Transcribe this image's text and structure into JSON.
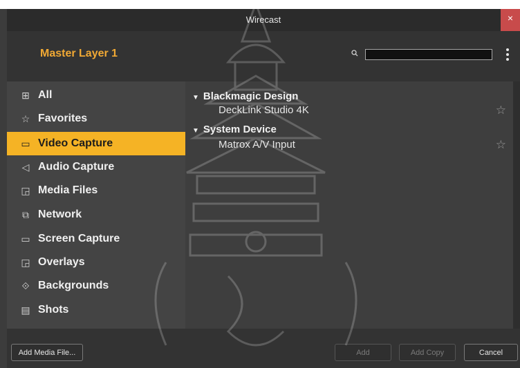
{
  "window": {
    "title": "Wirecast",
    "close_glyph": "×"
  },
  "header": {
    "layer_name": "Master Layer 1",
    "search_value": "",
    "search_icon": "search-icon",
    "more_icon": "⋮"
  },
  "sidebar": {
    "items": [
      {
        "label": "All",
        "icon": "⊞",
        "icon_name": "grid-icon",
        "active": false
      },
      {
        "label": "Favorites",
        "icon": "☆",
        "icon_name": "star-icon",
        "active": false
      },
      {
        "label": "Video Capture",
        "icon": "▭",
        "icon_name": "camera-icon",
        "active": true
      },
      {
        "label": "Audio Capture",
        "icon": "◁",
        "icon_name": "speaker-icon",
        "active": false
      },
      {
        "label": "Media Files",
        "icon": "◲",
        "icon_name": "media-files-icon",
        "active": false
      },
      {
        "label": "Network",
        "icon": "⧉",
        "icon_name": "network-icon",
        "active": false
      },
      {
        "label": "Screen Capture",
        "icon": "▭",
        "icon_name": "monitor-icon",
        "active": false
      },
      {
        "label": "Overlays",
        "icon": "◲",
        "icon_name": "overlays-icon",
        "active": false
      },
      {
        "label": "Backgrounds",
        "icon": "⟐",
        "icon_name": "layers-icon",
        "active": false
      },
      {
        "label": "Shots",
        "icon": "▤",
        "icon_name": "shots-icon",
        "active": false
      }
    ]
  },
  "main": {
    "groups": [
      {
        "name": "Blackmagic Design",
        "devices": [
          "DeckLink Studio 4K"
        ]
      },
      {
        "name": "System Device",
        "devices": [
          "Matrox A/V Input"
        ]
      }
    ],
    "star_glyph": "☆",
    "triangle_glyph": "▼"
  },
  "footer": {
    "add_media_label": "Add Media File...",
    "add_label": "Add",
    "add_copy_label": "Add Copy",
    "cancel_label": "Cancel"
  },
  "colors": {
    "accent": "#f5b325",
    "layer_title": "#f1a934",
    "close": "#c84b4b"
  }
}
